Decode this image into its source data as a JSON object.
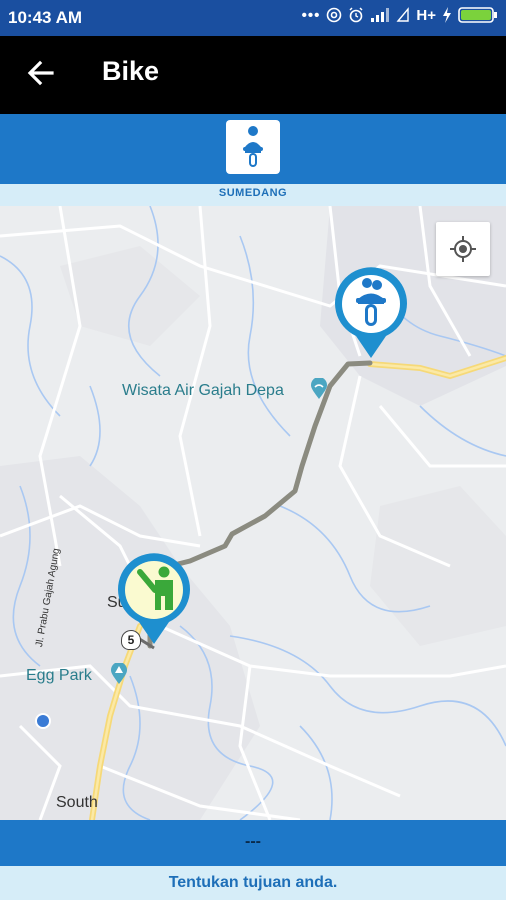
{
  "status_bar": {
    "time": "10:43 AM",
    "network": "H+",
    "icons": [
      "dots-icon",
      "at-icon",
      "alarm-icon",
      "signal-icon",
      "signal-icon",
      "bolt-icon",
      "battery-icon"
    ]
  },
  "toolbar": {
    "title": "Bike",
    "back_icon": "arrow-left-icon"
  },
  "vehicle_selector": {
    "selected": "bike",
    "icon": "motorbike-rider-icon"
  },
  "location_label": "SUMEDANG",
  "map": {
    "labels": {
      "poi": "Wisata Air Gajah Depa",
      "egg_park": "Egg Park",
      "street": "Jl. Prabu Gajah Agung",
      "town_partial": "Sumedang",
      "south": "South",
      "route_shield": "5"
    },
    "markers": {
      "driver": "bike-driver-marker-icon",
      "pickup": "hailing-passenger-marker-icon"
    },
    "locate_button_icon": "my-location-icon"
  },
  "bottom_bar": {
    "text": "---"
  },
  "hint": "Tentukan tujuan anda."
}
